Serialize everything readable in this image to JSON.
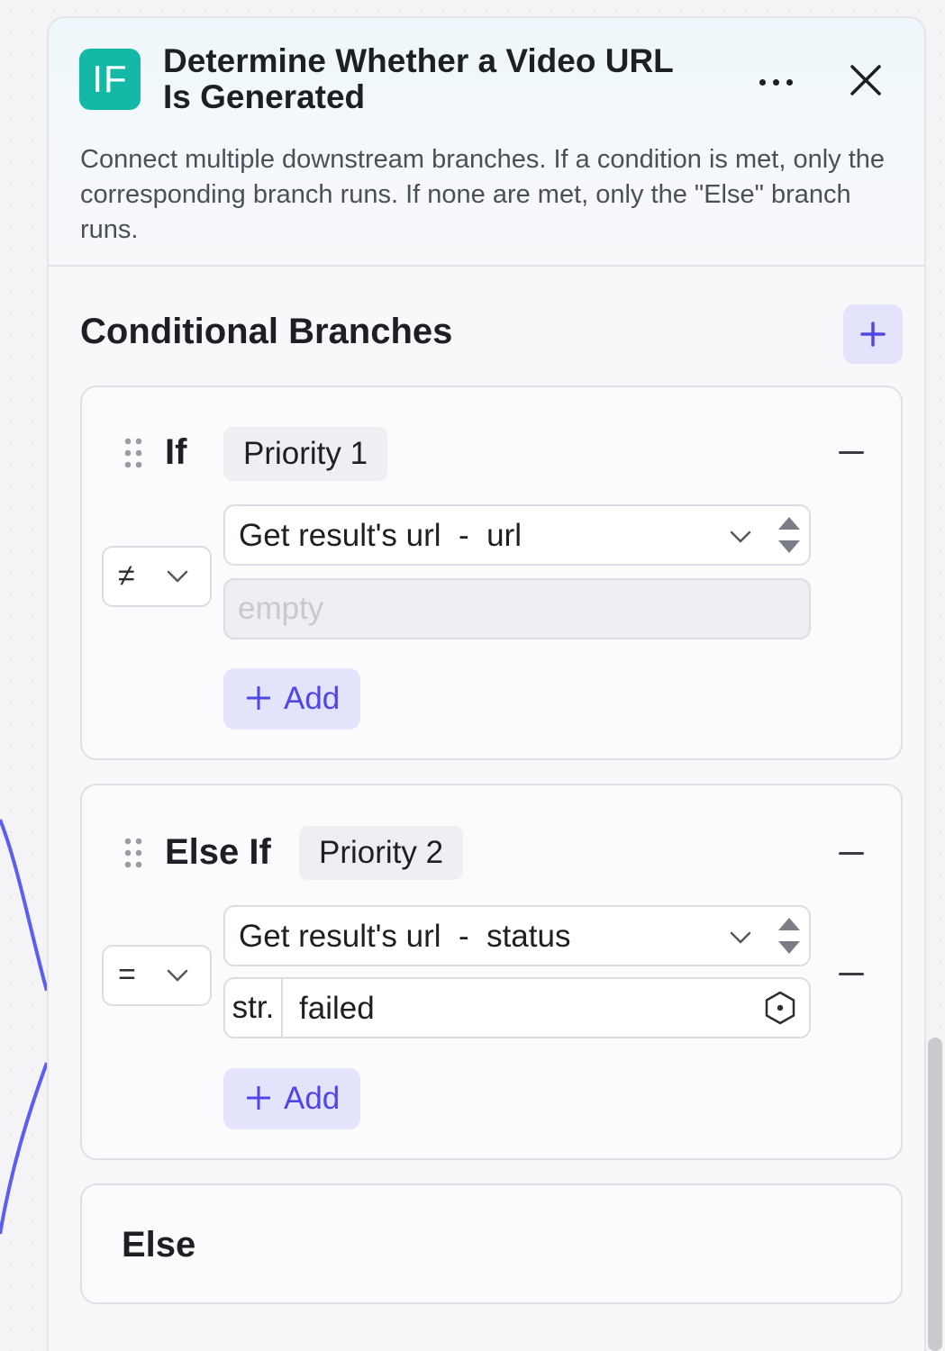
{
  "panel": {
    "icon_text": "IF",
    "title": "Determine Whether a Video URL Is Generated",
    "description": "Connect multiple downstream branches. If a condition is met, only the corresponding branch runs. If none are met, only the \"Else\" branch runs."
  },
  "section": {
    "title": "Conditional Branches"
  },
  "branches": [
    {
      "label": "If",
      "priority": "Priority 1",
      "operator": "≠",
      "variable": "Get result's url  -  url",
      "value_placeholder": "empty",
      "add_label": "Add"
    },
    {
      "label": "Else If",
      "priority": "Priority 2",
      "operator": "=",
      "variable": "Get result's url  -  status",
      "value_type": "str.",
      "value": "failed",
      "add_label": "Add"
    }
  ],
  "else_branch": {
    "label": "Else"
  },
  "colors": {
    "accent": "#4f46e5",
    "node_icon": "#14b8a6",
    "edge": "#5b5ef0"
  },
  "icons": [
    "more-icon",
    "close-icon",
    "plus-icon",
    "drag-handle-icon",
    "minus-icon",
    "chevron-down-icon",
    "stepper-icon",
    "variable-reference-icon"
  ]
}
